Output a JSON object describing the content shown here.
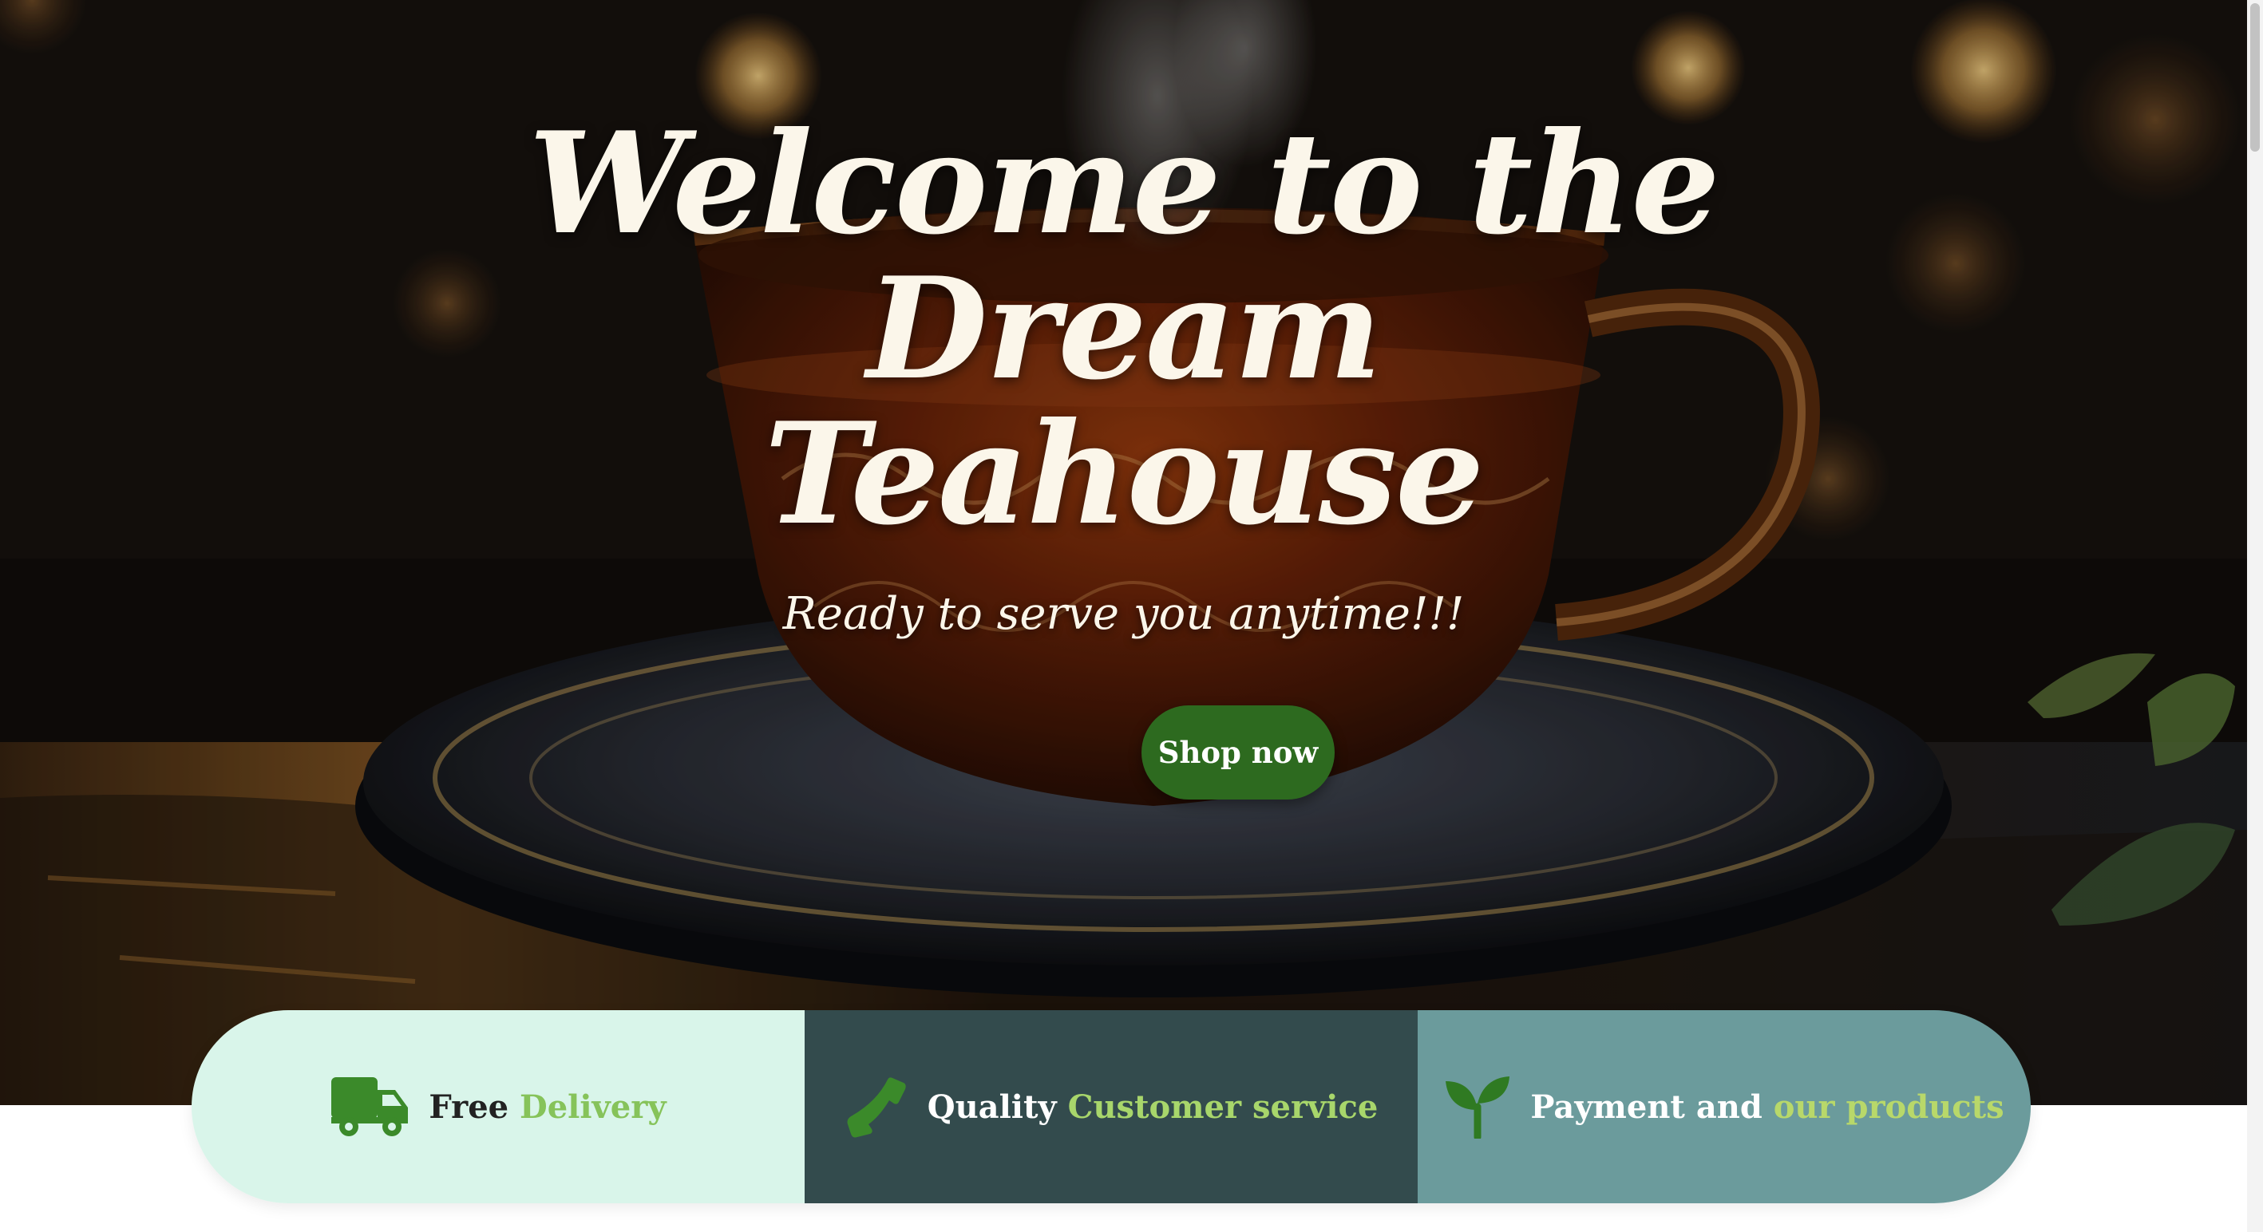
{
  "hero": {
    "headline_line1": "Welcome to the",
    "headline_line2": "Dream",
    "headline_line3": "Teahouse",
    "subline": "Ready to serve you anytime!!!",
    "cta_label": "Shop now"
  },
  "features": [
    {
      "icon": "delivery-truck-icon",
      "prefix": "Free",
      "accent": "Delivery"
    },
    {
      "icon": "phone-icon",
      "prefix": "Quality",
      "accent": "Customer service"
    },
    {
      "icon": "sprout-icon",
      "prefix": "Payment and",
      "accent": "our products"
    }
  ],
  "colors": {
    "cta_bg": "#2d6a1f",
    "feature1_bg": "#d9f5ea",
    "feature2_bg": "#334b4d",
    "feature3_bg": "#6b9b9c",
    "accent_green": "#86c35a",
    "icon_green": "#3b8a2a"
  }
}
